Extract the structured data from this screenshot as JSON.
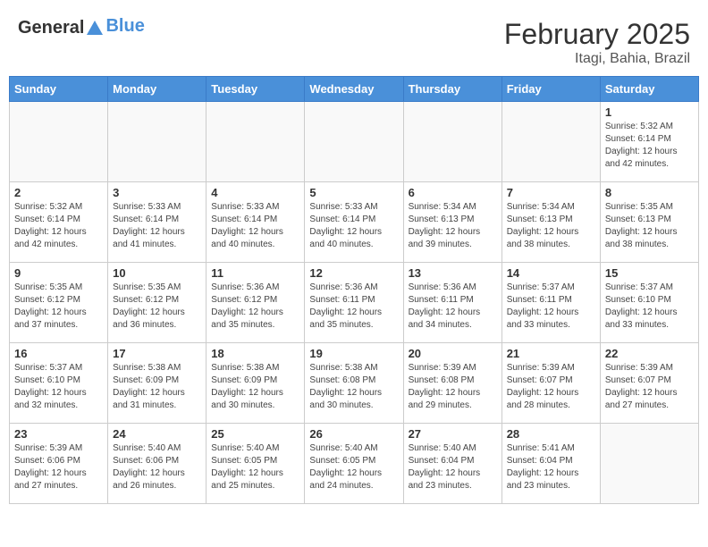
{
  "header": {
    "logo_general": "General",
    "logo_blue": "Blue",
    "month_year": "February 2025",
    "location": "Itagi, Bahia, Brazil"
  },
  "days_of_week": [
    "Sunday",
    "Monday",
    "Tuesday",
    "Wednesday",
    "Thursday",
    "Friday",
    "Saturday"
  ],
  "weeks": [
    [
      {
        "day": "",
        "info": ""
      },
      {
        "day": "",
        "info": ""
      },
      {
        "day": "",
        "info": ""
      },
      {
        "day": "",
        "info": ""
      },
      {
        "day": "",
        "info": ""
      },
      {
        "day": "",
        "info": ""
      },
      {
        "day": "1",
        "info": "Sunrise: 5:32 AM\nSunset: 6:14 PM\nDaylight: 12 hours\nand 42 minutes."
      }
    ],
    [
      {
        "day": "2",
        "info": "Sunrise: 5:32 AM\nSunset: 6:14 PM\nDaylight: 12 hours\nand 42 minutes."
      },
      {
        "day": "3",
        "info": "Sunrise: 5:33 AM\nSunset: 6:14 PM\nDaylight: 12 hours\nand 41 minutes."
      },
      {
        "day": "4",
        "info": "Sunrise: 5:33 AM\nSunset: 6:14 PM\nDaylight: 12 hours\nand 40 minutes."
      },
      {
        "day": "5",
        "info": "Sunrise: 5:33 AM\nSunset: 6:14 PM\nDaylight: 12 hours\nand 40 minutes."
      },
      {
        "day": "6",
        "info": "Sunrise: 5:34 AM\nSunset: 6:13 PM\nDaylight: 12 hours\nand 39 minutes."
      },
      {
        "day": "7",
        "info": "Sunrise: 5:34 AM\nSunset: 6:13 PM\nDaylight: 12 hours\nand 38 minutes."
      },
      {
        "day": "8",
        "info": "Sunrise: 5:35 AM\nSunset: 6:13 PM\nDaylight: 12 hours\nand 38 minutes."
      }
    ],
    [
      {
        "day": "9",
        "info": "Sunrise: 5:35 AM\nSunset: 6:12 PM\nDaylight: 12 hours\nand 37 minutes."
      },
      {
        "day": "10",
        "info": "Sunrise: 5:35 AM\nSunset: 6:12 PM\nDaylight: 12 hours\nand 36 minutes."
      },
      {
        "day": "11",
        "info": "Sunrise: 5:36 AM\nSunset: 6:12 PM\nDaylight: 12 hours\nand 35 minutes."
      },
      {
        "day": "12",
        "info": "Sunrise: 5:36 AM\nSunset: 6:11 PM\nDaylight: 12 hours\nand 35 minutes."
      },
      {
        "day": "13",
        "info": "Sunrise: 5:36 AM\nSunset: 6:11 PM\nDaylight: 12 hours\nand 34 minutes."
      },
      {
        "day": "14",
        "info": "Sunrise: 5:37 AM\nSunset: 6:11 PM\nDaylight: 12 hours\nand 33 minutes."
      },
      {
        "day": "15",
        "info": "Sunrise: 5:37 AM\nSunset: 6:10 PM\nDaylight: 12 hours\nand 33 minutes."
      }
    ],
    [
      {
        "day": "16",
        "info": "Sunrise: 5:37 AM\nSunset: 6:10 PM\nDaylight: 12 hours\nand 32 minutes."
      },
      {
        "day": "17",
        "info": "Sunrise: 5:38 AM\nSunset: 6:09 PM\nDaylight: 12 hours\nand 31 minutes."
      },
      {
        "day": "18",
        "info": "Sunrise: 5:38 AM\nSunset: 6:09 PM\nDaylight: 12 hours\nand 30 minutes."
      },
      {
        "day": "19",
        "info": "Sunrise: 5:38 AM\nSunset: 6:08 PM\nDaylight: 12 hours\nand 30 minutes."
      },
      {
        "day": "20",
        "info": "Sunrise: 5:39 AM\nSunset: 6:08 PM\nDaylight: 12 hours\nand 29 minutes."
      },
      {
        "day": "21",
        "info": "Sunrise: 5:39 AM\nSunset: 6:07 PM\nDaylight: 12 hours\nand 28 minutes."
      },
      {
        "day": "22",
        "info": "Sunrise: 5:39 AM\nSunset: 6:07 PM\nDaylight: 12 hours\nand 27 minutes."
      }
    ],
    [
      {
        "day": "23",
        "info": "Sunrise: 5:39 AM\nSunset: 6:06 PM\nDaylight: 12 hours\nand 27 minutes."
      },
      {
        "day": "24",
        "info": "Sunrise: 5:40 AM\nSunset: 6:06 PM\nDaylight: 12 hours\nand 26 minutes."
      },
      {
        "day": "25",
        "info": "Sunrise: 5:40 AM\nSunset: 6:05 PM\nDaylight: 12 hours\nand 25 minutes."
      },
      {
        "day": "26",
        "info": "Sunrise: 5:40 AM\nSunset: 6:05 PM\nDaylight: 12 hours\nand 24 minutes."
      },
      {
        "day": "27",
        "info": "Sunrise: 5:40 AM\nSunset: 6:04 PM\nDaylight: 12 hours\nand 23 minutes."
      },
      {
        "day": "28",
        "info": "Sunrise: 5:41 AM\nSunset: 6:04 PM\nDaylight: 12 hours\nand 23 minutes."
      },
      {
        "day": "",
        "info": ""
      }
    ]
  ]
}
